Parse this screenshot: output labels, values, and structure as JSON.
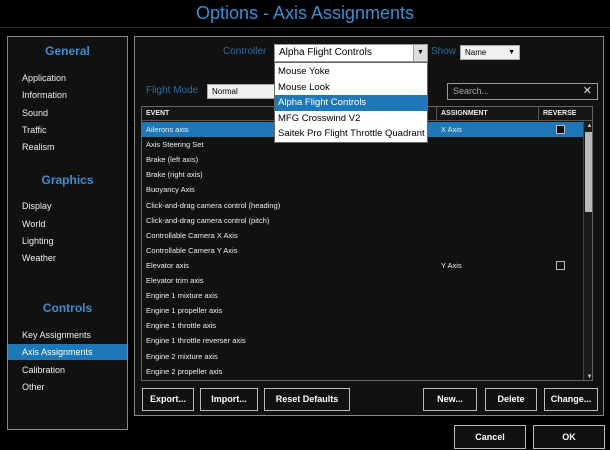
{
  "window": {
    "title": "Options - Axis Assignments"
  },
  "sidebar": {
    "sections": [
      {
        "header": "General",
        "items": [
          "Application",
          "Information",
          "Sound",
          "Traffic",
          "Realism"
        ]
      },
      {
        "header": "Graphics",
        "items": [
          "Display",
          "World",
          "Lighting",
          "Weather"
        ]
      },
      {
        "header": "Controls",
        "items": [
          "Key Assignments",
          "Axis Assignments",
          "Calibration",
          "Other"
        ]
      }
    ],
    "active_item": "Axis Assignments"
  },
  "toolbar": {
    "controller_label": "Controller",
    "controller_value": "Alpha Flight Controls",
    "show_label": "Show",
    "show_value": "Name",
    "flight_mode_label": "Flight Mode",
    "flight_mode_value": "Normal",
    "search_placeholder": "Search..."
  },
  "controller_dropdown": {
    "options": [
      "Mouse Yoke",
      "Mouse Look",
      "Alpha Flight Controls",
      "MFG Crosswind V2",
      "Saitek Pro Flight Throttle Quadrant"
    ],
    "highlighted": "Alpha Flight Controls"
  },
  "table": {
    "columns": [
      "EVENT",
      "ASSIGNMENT",
      "REVERSE"
    ],
    "rows": [
      {
        "event": "Ailerons axis",
        "assignment": "X Axis",
        "reverse": true,
        "selected": true
      },
      {
        "event": "Axis Steering Set",
        "assignment": "",
        "reverse": false
      },
      {
        "event": "Brake (left axis)",
        "assignment": "",
        "reverse": false
      },
      {
        "event": "Brake (right axis)",
        "assignment": "",
        "reverse": false
      },
      {
        "event": "Buoyancy Axis",
        "assignment": "",
        "reverse": false
      },
      {
        "event": "Click-and-drag camera control (heading)",
        "assignment": "",
        "reverse": false
      },
      {
        "event": "Click-and-drag camera control (pitch)",
        "assignment": "",
        "reverse": false
      },
      {
        "event": "Controllable Camera X Axis",
        "assignment": "",
        "reverse": false
      },
      {
        "event": "Controllable Camera Y Axis",
        "assignment": "",
        "reverse": false
      },
      {
        "event": "Elevator axis",
        "assignment": "Y Axis",
        "reverse": true
      },
      {
        "event": "Elevator trim axis",
        "assignment": "",
        "reverse": false
      },
      {
        "event": "Engine 1 mixture axis",
        "assignment": "",
        "reverse": false
      },
      {
        "event": "Engine 1 propeller axis",
        "assignment": "",
        "reverse": false
      },
      {
        "event": "Engine 1 throttle axis",
        "assignment": "",
        "reverse": false
      },
      {
        "event": "Engine 1 throttle reverser axis",
        "assignment": "",
        "reverse": false
      },
      {
        "event": "Engine 2 mixture axis",
        "assignment": "",
        "reverse": false
      },
      {
        "event": "Engine 2 propeller axis",
        "assignment": "",
        "reverse": false
      }
    ]
  },
  "actions": {
    "export": "Export...",
    "import": "Import...",
    "reset": "Reset Defaults",
    "new": "New...",
    "delete": "Delete",
    "change": "Change..."
  },
  "footer": {
    "cancel": "Cancel",
    "ok": "OK"
  },
  "colors": {
    "accent": "#3a8fd0",
    "selection": "#1e78b8",
    "background": "#000000"
  },
  "icons": {
    "dropdown": "chevron-down-icon",
    "clear_search": "close-icon"
  }
}
